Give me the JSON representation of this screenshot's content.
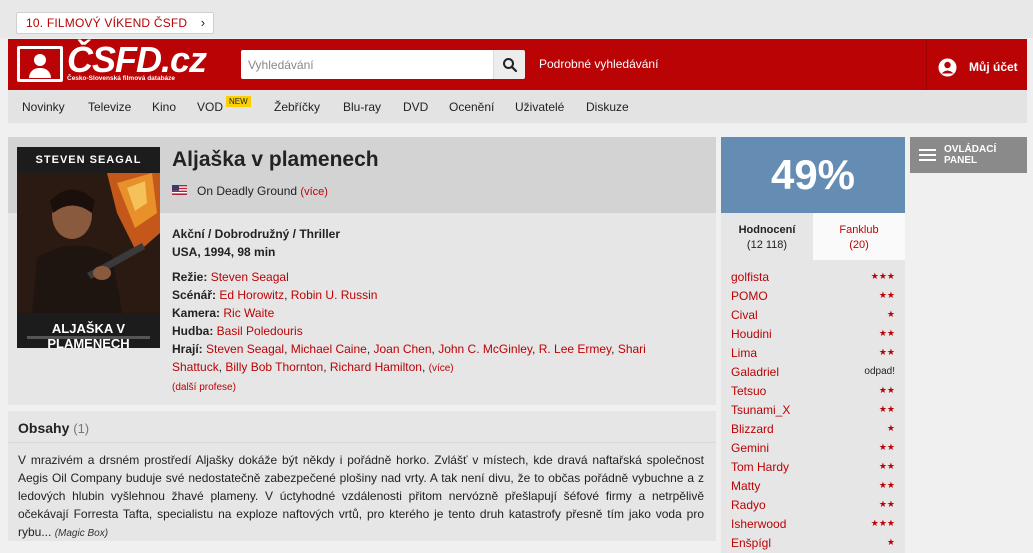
{
  "promo": {
    "label": "10. FILMOVÝ VÍKEND ČSFD"
  },
  "header": {
    "logo_text": "ČSFD.cz",
    "logo_sub": "Česko-Slovenská filmová databáze",
    "search_placeholder": "Vyhledávání",
    "advanced_search": "Podrobné vyhledávání",
    "account": "Můj účet"
  },
  "nav": {
    "items": [
      "Novinky",
      "Televize",
      "Kino",
      "VOD",
      "Žebříčky",
      "Blu-ray",
      "DVD",
      "Ocenění",
      "Uživatelé",
      "Diskuze"
    ],
    "vod_badge": "NEW"
  },
  "film": {
    "poster_actor": "STEVEN SEAGAL",
    "poster_title": "ALJAŠKA V PLAMENECH",
    "title": "Aljaška v plamenech",
    "original_title": "On Deadly Ground",
    "more": "(více)",
    "genres": "Akční / Dobrodružný / Thriller",
    "origin": "USA, 1994, 98 min",
    "directing_label": "Režie:",
    "directing": "Steven Seagal",
    "screenplay_label": "Scénář:",
    "screenplay_1": "Ed Horowitz",
    "screenplay_2": "Robin U. Russin",
    "camera_label": "Kamera:",
    "camera": "Ric Waite",
    "music_label": "Hudba:",
    "music": "Basil Poledouris",
    "cast_label": "Hrají:",
    "cast_1": "Steven Seagal",
    "cast_2": "Michael Caine",
    "cast_3": "Joan Chen",
    "cast_4": "John C. McGinley",
    "cast_5": "R. Lee Ermey",
    "cast_6": "Shari Shattuck",
    "cast_7": "Billy Bob Thornton",
    "cast_8": "Richard Hamilton",
    "cast_more": "(více)",
    "more_professions": "(další profese)"
  },
  "plot": {
    "title": "Obsahy",
    "count": "(1)",
    "text": "V mrazivém a drsném prostředí Aljašky dokáže být někdy i pořádně horko. Zvlášť v místech, kde dravá naftařská společnost Aegis Oil Company buduje své nedostatečně zabezpečené plošiny nad vrty. A tak není divu, že to občas pořádně vybuchne a z ledových hlubin vyšlehnou žhavé plameny. V úctyhodné vzdálenosti přitom nervózně přešlapují šéfové firmy a netrpělivě očekávají Forresta Tafta, specialistu na exploze naftových vrtů, pro kterého je tento druh katastrofy přesně tím jako voda pro rybu...",
    "author": "(Magic Box)"
  },
  "rating": {
    "value": "49%",
    "tab_ratings": "Hodnocení",
    "tab_ratings_count": "(12 118)",
    "tab_fanclub": "Fanklub",
    "tab_fanclub_count": "(20)",
    "users": [
      {
        "name": "golfista",
        "stars": "★★★"
      },
      {
        "name": "POMO",
        "stars": "★★"
      },
      {
        "name": "Cival",
        "stars": "★"
      },
      {
        "name": "Houdini",
        "stars": "★★"
      },
      {
        "name": "Lima",
        "stars": "★★"
      },
      {
        "name": "Galadriel",
        "text": "odpad!"
      },
      {
        "name": "Tetsuo",
        "stars": "★★"
      },
      {
        "name": "Tsunami_X",
        "stars": "★★"
      },
      {
        "name": "Blizzard",
        "stars": "★"
      },
      {
        "name": "Gemini",
        "stars": "★★"
      },
      {
        "name": "Tom Hardy",
        "stars": "★★"
      },
      {
        "name": "Matty",
        "stars": "★★"
      },
      {
        "name": "Radyo",
        "stars": "★★"
      },
      {
        "name": "Isherwood",
        "stars": "★★★"
      },
      {
        "name": "Enšpígl",
        "stars": "★"
      }
    ]
  },
  "control_panel": {
    "line1": "OVLÁDACÍ",
    "line2": "PANEL"
  }
}
